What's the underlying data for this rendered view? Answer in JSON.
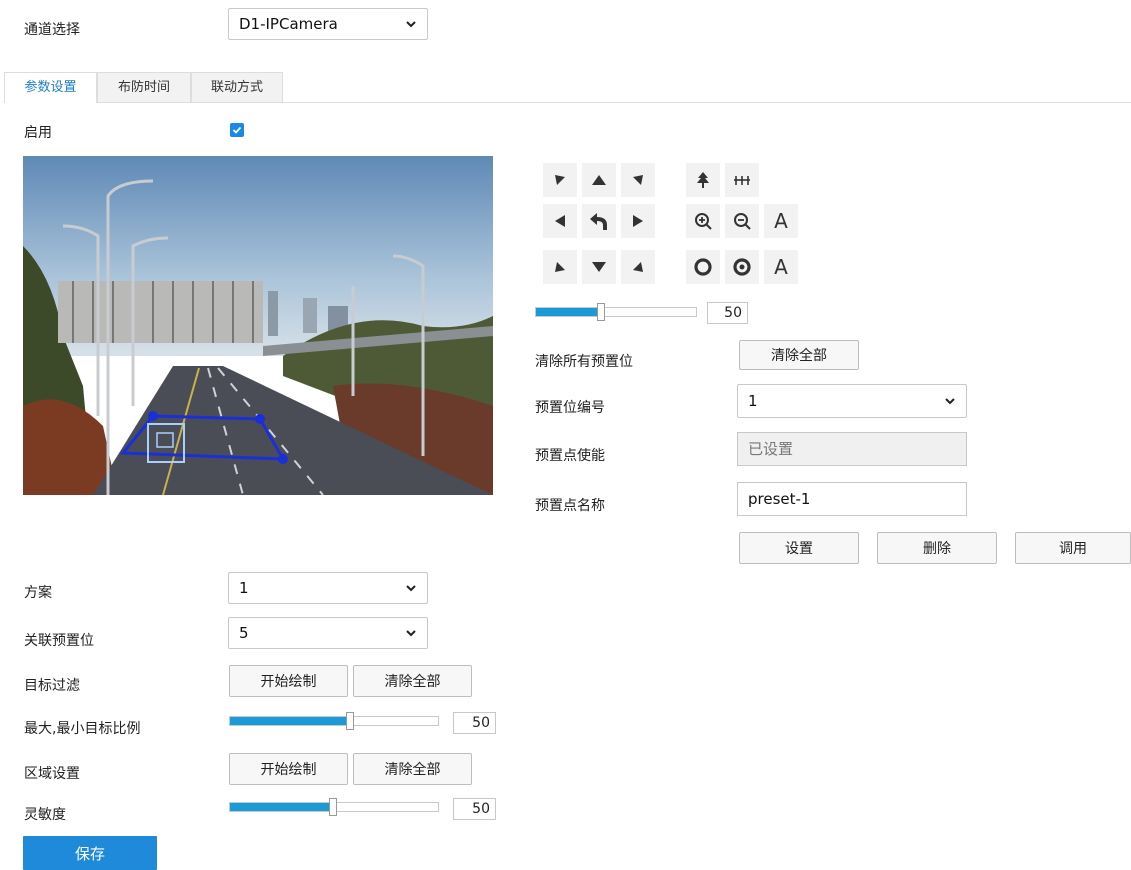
{
  "channel": {
    "label": "通道选择",
    "value": "D1-IPCamera"
  },
  "tabs": [
    {
      "label": "参数设置",
      "active": true
    },
    {
      "label": "布防时间",
      "active": false
    },
    {
      "label": "联动方式",
      "active": false
    }
  ],
  "enable": {
    "label": "启用",
    "checked": true
  },
  "ptz": {
    "zoom_label": "A",
    "iris_label": "A",
    "speed": {
      "value": "50",
      "fraction": 0.4
    }
  },
  "preset": {
    "clear_all_label": "清除所有预置位",
    "clear_all_button": "清除全部",
    "number_label": "预置位编号",
    "number_value": "1",
    "enable_label": "预置点使能",
    "enable_value": "已设置",
    "name_label": "预置点名称",
    "name_value": "preset-1",
    "set_button": "设置",
    "delete_button": "删除",
    "call_button": "调用"
  },
  "scheme": {
    "label": "方案",
    "value": "1"
  },
  "linked_preset": {
    "label": "关联预置位",
    "value": "5"
  },
  "target_filter": {
    "label": "目标过滤",
    "draw_button": "开始绘制",
    "clear_button": "清除全部"
  },
  "ratio": {
    "label": "最大,最小目标比例",
    "value": "50",
    "fraction": 0.57
  },
  "area": {
    "label": "区域设置",
    "draw_button": "开始绘制",
    "clear_button": "清除全部"
  },
  "sensitivity": {
    "label": "灵敏度",
    "value": "50",
    "fraction": 0.49
  },
  "save_label": "保存",
  "colors": {
    "accent": "#1f8ad9",
    "slider": "#1a9ad6",
    "tab_active": "#1f7fc6",
    "roi": "#1a2fd8"
  }
}
